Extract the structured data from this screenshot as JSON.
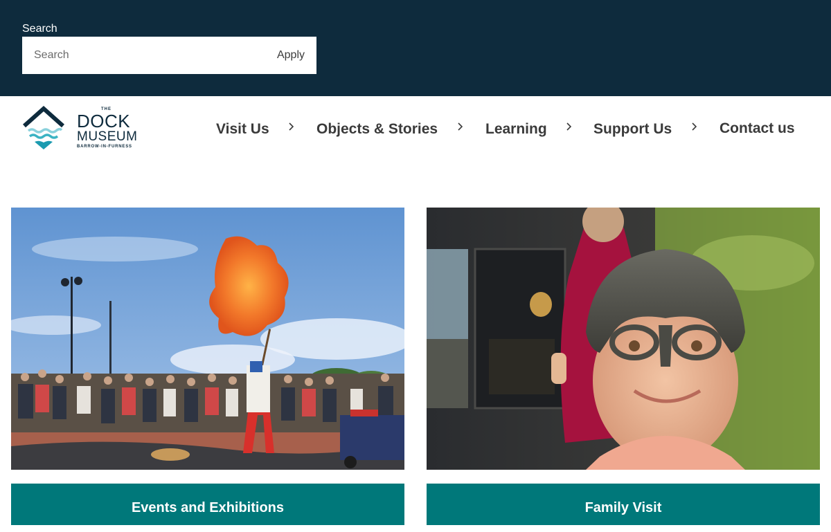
{
  "search": {
    "label": "Search",
    "placeholder": "Search",
    "value": "",
    "apply_label": "Apply"
  },
  "logo": {
    "the": "THE",
    "line1": "DOCK",
    "line2": "MUSEUM",
    "location": "BARROW-IN-FURNESS"
  },
  "nav": {
    "items": [
      {
        "label": "Visit Us",
        "has_submenu": true
      },
      {
        "label": "Objects & Stories",
        "has_submenu": true
      },
      {
        "label": "Learning",
        "has_submenu": true
      },
      {
        "label": "Support Us",
        "has_submenu": true
      },
      {
        "label": "Contact us",
        "has_submenu": false
      }
    ]
  },
  "cards": [
    {
      "image": "fire-performer-photo",
      "button_label": "Events and Exhibitions"
    },
    {
      "image": "child-viking-helmet-photo",
      "button_label": "Family Visit"
    }
  ],
  "colors": {
    "header_bg": "#0e2b3d",
    "nav_text": "#3a3a3a",
    "accent_teal": "#00787a",
    "logo_teal": "#3bb3c3"
  }
}
